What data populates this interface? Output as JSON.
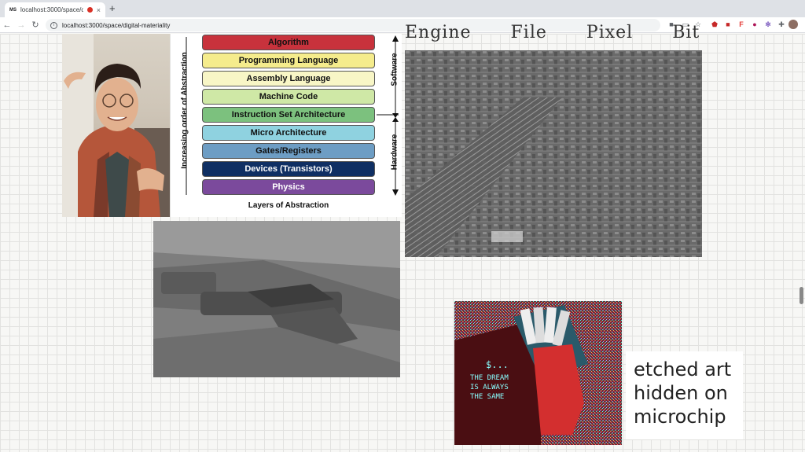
{
  "browser": {
    "tab_favicon": "MS",
    "tab_title": "localhost:3000/space/digi",
    "tab_close": "×",
    "new_tab": "+",
    "url": "localhost:3000/space/digital-materiality"
  },
  "heading": {
    "words": [
      "Engine",
      "File",
      "Pixel",
      "Bit"
    ]
  },
  "abstraction": {
    "layers": [
      {
        "label": "Algorithm",
        "color": "#c8323c"
      },
      {
        "label": "Programming Language",
        "color": "#f5ec8c"
      },
      {
        "label": "Assembly Language",
        "color": "#f8f6c6"
      },
      {
        "label": "Machine Code",
        "color": "#cfe8a6"
      },
      {
        "label": "Instruction Set Architecture",
        "color": "#7cc17e"
      },
      {
        "label": "Micro Architecture",
        "color": "#8fd2e0"
      },
      {
        "label": "Gates/Registers",
        "color": "#6d9dc4"
      },
      {
        "label": "Devices (Transistors)",
        "color": "#0f2f63"
      },
      {
        "label": "Physics",
        "color": "#7b4a9c"
      }
    ],
    "axis_label": "Increasing order of Abstraction",
    "software_label": "Software",
    "hardware_label": "Hardware",
    "caption": "Layers of Abstraction"
  },
  "caption_card": {
    "lines": [
      "etched art",
      "hidden on",
      "microchip"
    ]
  },
  "chip_art": {
    "line1": "$...",
    "line2": "THE DREAM",
    "line3": "IS ALWAYS",
    "line4": "THE SAME"
  }
}
